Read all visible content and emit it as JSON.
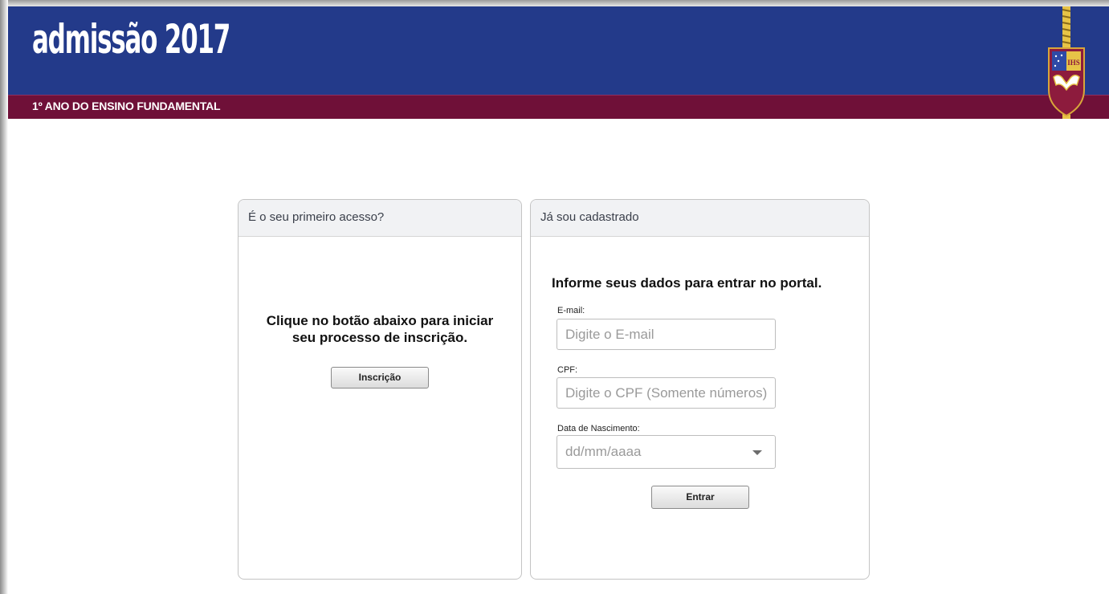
{
  "header": {
    "brand_title": "admissão 2017",
    "subtitle": "1º ANO DO ENSINO FUNDAMENTAL",
    "crest_logo": "school-crest-logo",
    "crest_text": "IHS"
  },
  "first_access": {
    "title": "É o seu primeiro acesso?",
    "message_line1": "Clique no botão abaixo para iniciar",
    "message_line2": "seu processo de inscrição.",
    "button_label": "Inscrição"
  },
  "registered": {
    "title": "Já sou cadastrado",
    "heading": "Informe seus dados para entrar no portal.",
    "email_label": "E-mail:",
    "email_placeholder": "Digite o E-mail",
    "cpf_label": "CPF:",
    "cpf_placeholder": "Digite o CPF (Somente números)",
    "birth_label": "Data de Nascimento:",
    "birth_placeholder": "dd/mm/aaaa",
    "submit_label": "Entrar"
  },
  "colors": {
    "header_blue": "#233a8a",
    "header_red": "#6f1038",
    "panel_header_bg": "#f1f2f4",
    "panel_border": "#c4c4c4"
  }
}
